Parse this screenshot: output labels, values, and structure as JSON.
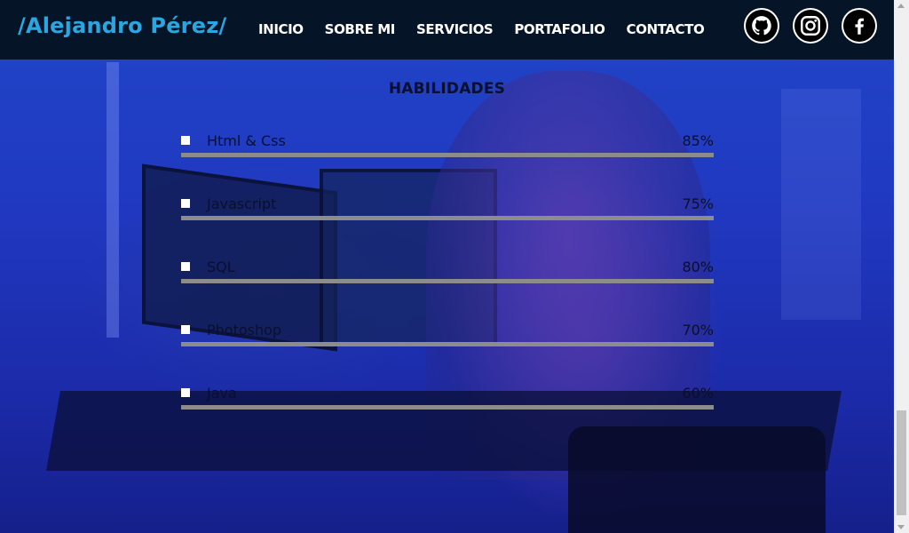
{
  "header": {
    "logo": "/Alejandro Pérez/",
    "nav": [
      {
        "label": "INICIO"
      },
      {
        "label": "SOBRE MI"
      },
      {
        "label": "SERVICIOS"
      },
      {
        "label": "PORTAFOLIO"
      },
      {
        "label": "CONTACTO"
      }
    ],
    "socials": [
      {
        "icon": "github-icon"
      },
      {
        "icon": "instagram-icon"
      },
      {
        "icon": "facebook-icon"
      }
    ]
  },
  "skills": {
    "title": "HABILIDADES",
    "items": [
      {
        "name": "Html & Css",
        "percent_label": "85%",
        "percent": 85
      },
      {
        "name": "Javascript",
        "percent_label": "75%",
        "percent": 75
      },
      {
        "name": "SQL",
        "percent_label": "80%",
        "percent": 80
      },
      {
        "name": "Photoshop",
        "percent_label": "70%",
        "percent": 70
      },
      {
        "name": "Java",
        "percent_label": "60%",
        "percent": 60
      }
    ]
  },
  "colors": {
    "header_bg": "#061428",
    "logo": "#2aa7e0",
    "text_dark": "#0a0f2e",
    "bar_track": "#8c8c8c"
  }
}
